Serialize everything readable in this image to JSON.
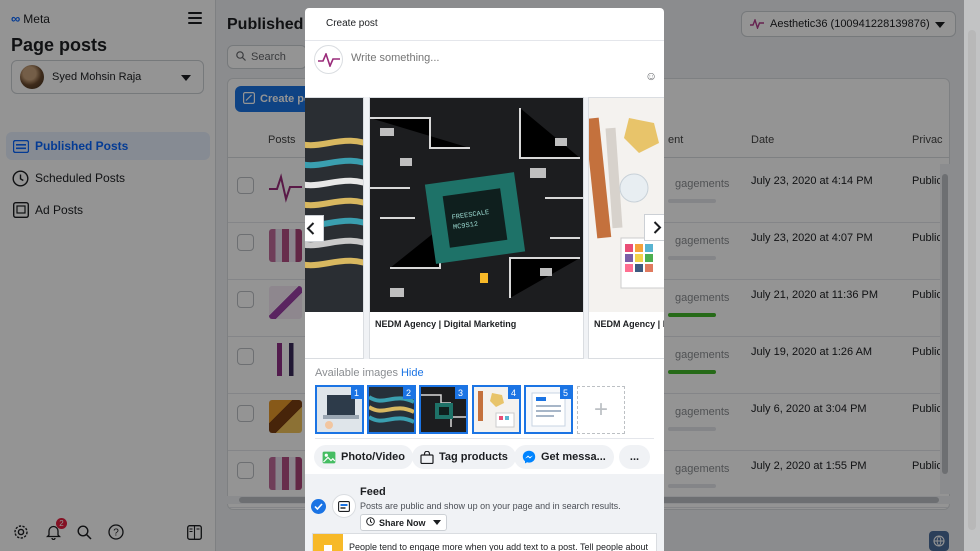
{
  "sidebar": {
    "brand": "Meta",
    "title": "Page posts",
    "account_name": "Syed Mohsin Raja",
    "nav": [
      {
        "label": "Published Posts",
        "icon": "list-icon",
        "active": true
      },
      {
        "label": "Scheduled Posts",
        "icon": "clock-icon",
        "active": false
      },
      {
        "label": "Ad Posts",
        "icon": "ad-icon",
        "active": false
      }
    ],
    "notification_count": "2"
  },
  "main": {
    "title": "Published posts",
    "search_placeholder": "Search",
    "create_label": "Create post",
    "page_selector": "Aesthetic36 (100941228139876)",
    "columns": {
      "posts": "Posts",
      "engagement": "ent",
      "date": "Date",
      "privacy": "Privac"
    },
    "rows": [
      {
        "engagement": "gagements",
        "date": "July 23, 2020 at 4:14 PM",
        "privacy": "Public",
        "bar": "gray"
      },
      {
        "engagement": "gagements",
        "date": "July 23, 2020 at 4:07 PM",
        "privacy": "Public",
        "bar": "gray"
      },
      {
        "engagement": "gagements",
        "date": "July 21, 2020 at 11:36 PM",
        "privacy": "Public",
        "bar": "green"
      },
      {
        "engagement": "gagements",
        "date": "July 19, 2020 at 1:26 AM",
        "privacy": "Public",
        "bar": "green"
      },
      {
        "engagement": "gagements",
        "date": "July 6, 2020 at 3:04 PM",
        "privacy": "Public",
        "bar": "gray"
      },
      {
        "engagement": "gagements",
        "date": "July 2, 2020 at 1:55 PM",
        "privacy": "Public",
        "bar": "gray"
      }
    ]
  },
  "modal": {
    "tab": "Create post",
    "composer_placeholder": "Write something...",
    "cards": [
      {
        "caption": ""
      },
      {
        "caption": "NEDM Agency | Digital Marketing"
      },
      {
        "caption": "NEDM Agency | Digital Marketing"
      }
    ],
    "available_label": "Available images",
    "hide_label": "Hide",
    "thumbnails": [
      "1",
      "2",
      "3",
      "4",
      "5"
    ],
    "actions": [
      "Photo/Video",
      "Tag products",
      "Get messa...",
      "..."
    ],
    "feed": {
      "title": "Feed",
      "description": "Posts are public and show up on your page and in search results.",
      "share": "Share Now"
    },
    "tip": "People tend to engage more when you add text to a post. Tell people about"
  },
  "colors": {
    "accent": "#1b74e4",
    "active_nav_bg": "#e7f0fd",
    "engagement_bar": "#42b72a"
  }
}
